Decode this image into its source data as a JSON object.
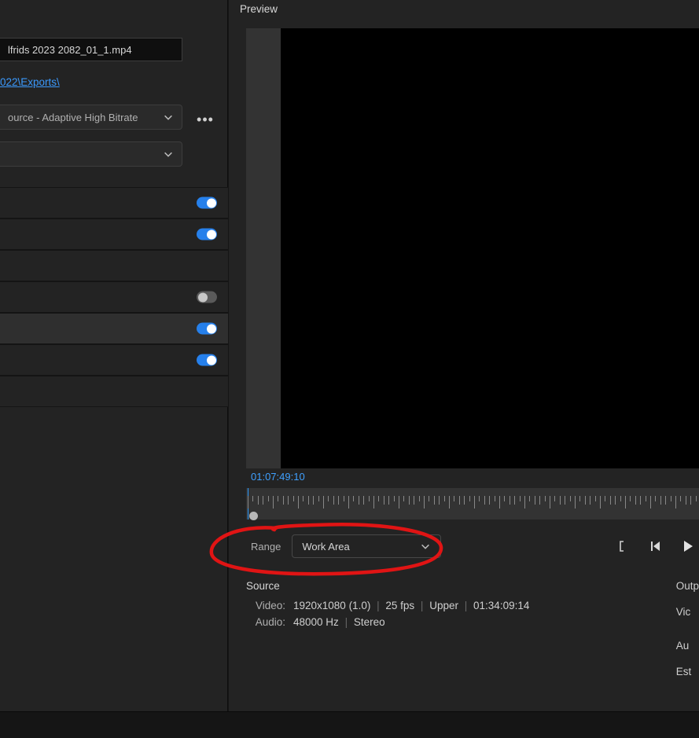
{
  "preview_label": "Preview",
  "filename": "lfrids 2023 2082_01_1.mp4",
  "export_path": "022\\Exports\\",
  "preset": {
    "label": "ource - Adaptive High Bitrate"
  },
  "second_dropdown": {
    "label": ""
  },
  "toggles": {
    "row1": "on",
    "row2": "on",
    "row3": "off",
    "row4": "on",
    "row5": "on"
  },
  "timecode": "01:07:49:10",
  "range": {
    "label": "Range",
    "value": "Work Area"
  },
  "source": {
    "heading": "Source",
    "video_label": "Video:",
    "video_res": "1920x1080 (1.0)",
    "video_fps": "25 fps",
    "video_field": "Upper",
    "video_dur": "01:34:09:14",
    "audio_label": "Audio:",
    "audio_hz": "48000 Hz",
    "audio_ch": "Stereo"
  },
  "output": {
    "heading": "Outp",
    "v": "Vic",
    "a": "Au",
    "e": "Est"
  }
}
